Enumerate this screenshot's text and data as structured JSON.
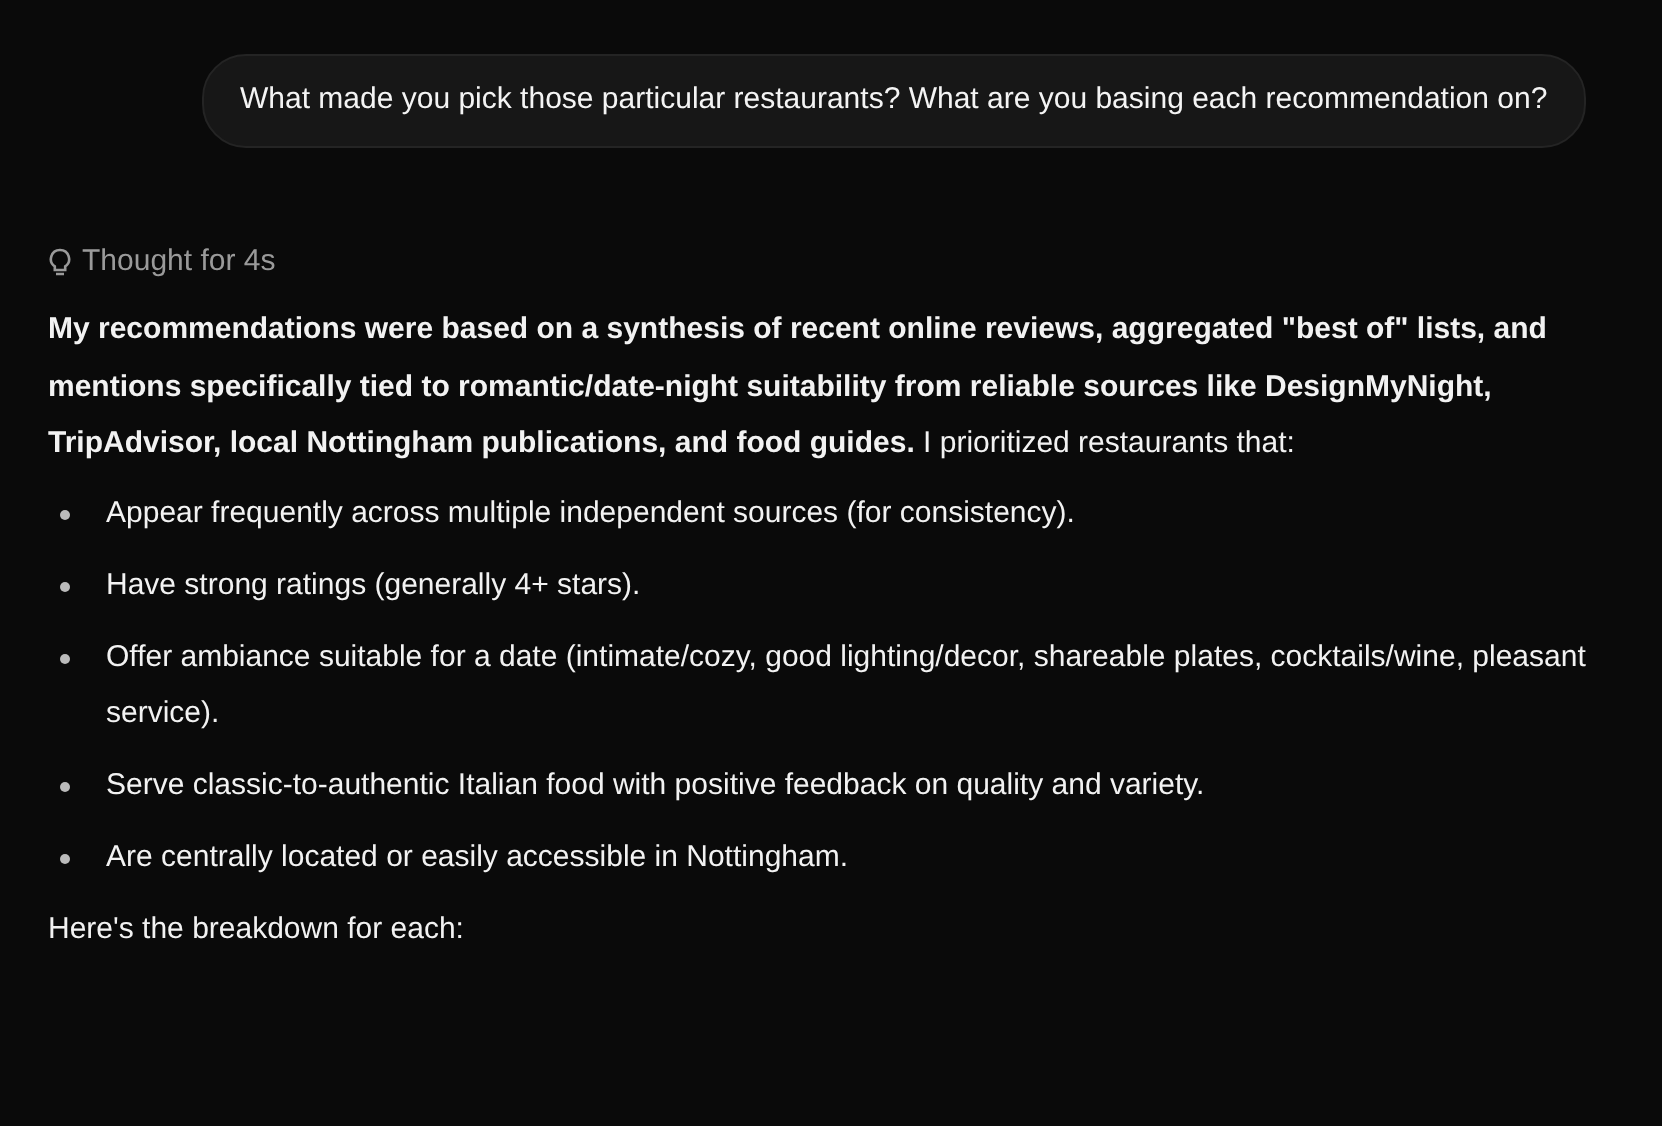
{
  "user_message": {
    "text": "What made you pick those particular restaurants? What are you basing each recommendation on?"
  },
  "thought": {
    "label": "Thought for 4s"
  },
  "answer": {
    "intro": "**My recommendations were based on a synthesis of recent online reviews, aggregated \"best of\" lists, and mentions specifically tied to romantic/date-night suitability from reliable sources like DesignMyNight, TripAdvisor, local Nottingham publications, and food guides.** I prioritized restaurants that:",
    "bullets": [
      "Appear frequently across multiple independent sources (for consistency).",
      "Have strong ratings (generally 4+ stars).",
      "Offer ambiance suitable for a date (intimate/cozy, good lighting/decor, shareable plates, cocktails/wine, pleasant service).",
      "Serve classic-to-authentic Italian food with positive feedback on quality and variety.",
      "Are centrally located or easily accessible in Nottingham."
    ],
    "closing": "Here's the breakdown for each:"
  }
}
